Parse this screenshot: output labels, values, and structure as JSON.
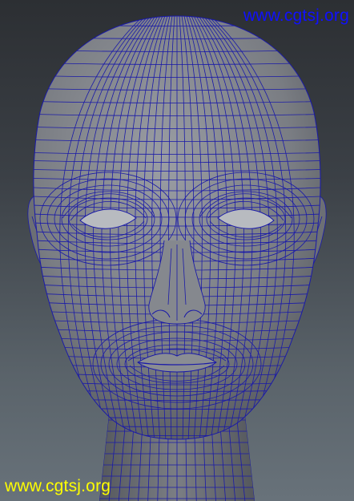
{
  "watermarks": {
    "top_text": "www.cgtsj.org",
    "bottom_text": "www.cgtsj.org",
    "top_color": "#1010ff",
    "bottom_color": "#ffff00"
  },
  "viewport": {
    "subject": "head-wireframe",
    "wire_color": "#1a1aa8",
    "surface_color": "#7c7f85"
  }
}
